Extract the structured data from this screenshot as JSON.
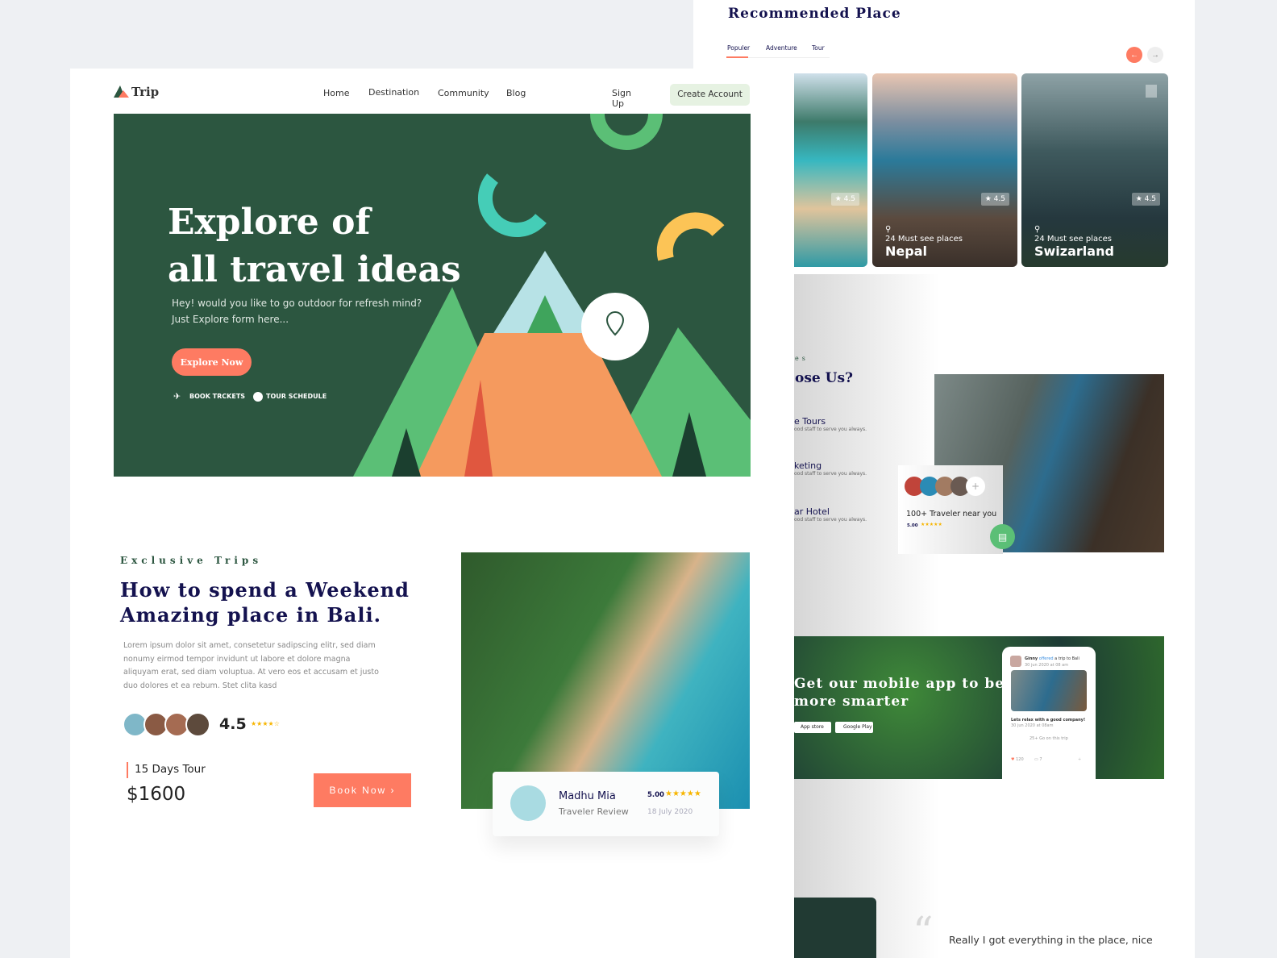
{
  "nav": {
    "logo": "Trip",
    "items": [
      "Home",
      "Destination",
      "Community",
      "Blog"
    ],
    "signup": "Sign Up",
    "create": "Create Account"
  },
  "hero": {
    "title1": "Explore of",
    "title2": "all travel ideas",
    "sub1": "Hey! would you like to go outdoor for refresh mind?",
    "sub2": "Just Explore form here...",
    "cta": "Explore Now",
    "link1": "BOOK TRCKETS",
    "link2": "TOUR SCHEDULE"
  },
  "trip": {
    "eyebrow": "Exclusive Trips",
    "title1": "How to spend a Weekend",
    "title2": "Amazing place in Bali.",
    "body": "Lorem ipsum dolor sit amet, consetetur sadipscing elitr, sed diam nonumy eirmod tempor invidunt ut labore et dolore magna aliquyam erat, sed diam voluptua. At vero eos et accusam et justo duo dolores et ea rebum. Stet clita kasd",
    "rating": "4.5",
    "stars": "★★★★☆",
    "duration": "15 Days Tour",
    "price": "$1600",
    "book": "Book Now  ›"
  },
  "review": {
    "name": "Madhu Mia",
    "role": "Traveler Review",
    "score": "5.00",
    "stars": "★★★★★",
    "date": "18 July 2020"
  },
  "recommended": {
    "title": "Recommended Place",
    "tabs": [
      "Populer",
      "Adventure",
      "Tour"
    ],
    "active_tab": 0,
    "cards": [
      {
        "rating": "★ 4.5",
        "count": "",
        "name": ""
      },
      {
        "rating": "★ 4.5",
        "count": "24 Must see places",
        "name": "Nepal"
      },
      {
        "rating": "★ 4.5",
        "count": "24 Must see places",
        "name": "Swizarland"
      }
    ]
  },
  "why": {
    "eyebrow": "es",
    "title": "ose Us?",
    "items": [
      {
        "t": "e Tours",
        "d": "ood staff to serve you always."
      },
      {
        "t": "keting",
        "d": "ood staff to serve you always."
      },
      {
        "t": "ar Hotel",
        "d": "ood staff to serve you always."
      }
    ],
    "travelers": "100+ Traveler near you",
    "score": "5.00",
    "stars": "★★★★★"
  },
  "app": {
    "title1": "Get our mobile app to be",
    "title2": "more smarter",
    "appstore": "App store",
    "googleplay": "Google Play",
    "post": {
      "user": "Ginny",
      "verb": "offered",
      "rest": "a trip to Bali",
      "time": "30 jun 2020 at 08 am",
      "caption": "Lets relax with a good company!",
      "ctime": "30 jun 2020 at 08am",
      "going": "25+ Go on this trip",
      "likes": "120",
      "comments": "7"
    }
  },
  "testimonial": {
    "quote": "Really I got everything in the place, nice"
  },
  "colors": {
    "accent": "#fe7b62",
    "hero": "#2c5640",
    "navy": "#14124f",
    "green": "#5bbf76"
  }
}
